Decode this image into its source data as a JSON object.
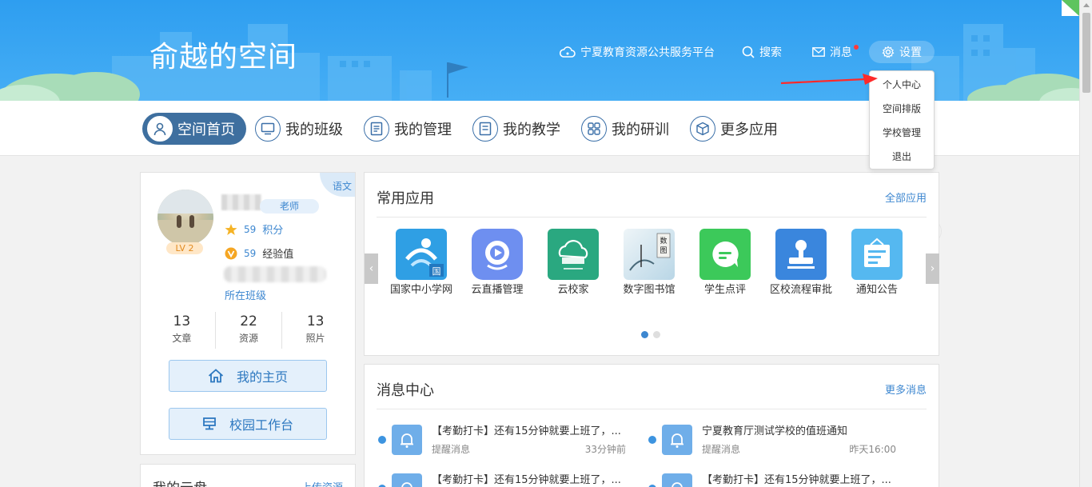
{
  "header": {
    "site_title": "俞越的空间",
    "platform_link": "宁夏教育资源公共服务平台",
    "search_label": "搜索",
    "message_label": "消息",
    "settings_label": "设置"
  },
  "settings_menu": {
    "items": [
      "个人中心",
      "空间排版",
      "学校管理",
      "退出"
    ]
  },
  "main_nav": {
    "items": [
      {
        "label": "空间首页",
        "icon": "user-icon",
        "active": true
      },
      {
        "label": "我的班级",
        "icon": "monitor-icon",
        "active": false
      },
      {
        "label": "我的管理",
        "icon": "document-icon",
        "active": false
      },
      {
        "label": "我的教学",
        "icon": "lesson-icon",
        "active": false
      },
      {
        "label": "我的研训",
        "icon": "grid-icon",
        "active": false
      },
      {
        "label": "更多应用",
        "icon": "cube-icon",
        "active": false
      }
    ]
  },
  "profile": {
    "subject_tag": "语文",
    "level": "LV 2",
    "role": "老师",
    "points_value": "59",
    "points_label": "积分",
    "exp_value": "59",
    "exp_label": "经验值",
    "class_link": "所在班级",
    "counts": [
      {
        "value": "13",
        "label": "文章"
      },
      {
        "value": "22",
        "label": "资源"
      },
      {
        "value": "13",
        "label": "照片"
      }
    ],
    "home_button": "我的主页",
    "workbench_button": "校园工作台"
  },
  "cloud_disk": {
    "title": "我的云盘",
    "upload_link": "上传资源"
  },
  "apps": {
    "title": "常用应用",
    "all_link": "全部应用",
    "items": [
      {
        "label": "国家中小学网",
        "icon": "national-school-icon",
        "color": "#2f9fe4"
      },
      {
        "label": "云直播管理",
        "icon": "live-play-icon",
        "color": "#6e8ff0"
      },
      {
        "label": "云校家",
        "icon": "cloud-school-icon",
        "color": "#2aa880"
      },
      {
        "label": "数字图书馆",
        "icon": "library-icon",
        "color": "#d8e8f0"
      },
      {
        "label": "学生点评",
        "icon": "chat-icon",
        "color": "#3cc95a"
      },
      {
        "label": "区校流程审批",
        "icon": "stamp-icon",
        "color": "#3a86dd"
      },
      {
        "label": "通知公告",
        "icon": "notice-icon",
        "color": "#55b8f0"
      }
    ],
    "page_count": 2,
    "current_page": 1
  },
  "messages": {
    "title": "消息中心",
    "more_link": "更多消息",
    "items": [
      {
        "title": "【考勤打卡】还有15分钟就要上班了，...",
        "type": "提醒消息",
        "time": "33分钟前"
      },
      {
        "title": "宁夏教育厅测试学校的值班通知",
        "type": "提醒消息",
        "time": "昨天16:00"
      },
      {
        "title": "【考勤打卡】还有15分钟就要上班了，...",
        "type": "",
        "time": ""
      },
      {
        "title": "【考勤打卡】还有15分钟就要上班了，...",
        "type": "",
        "time": ""
      }
    ]
  },
  "colors": {
    "header_blue": "#2e9ef0",
    "accent": "#3d87d0",
    "nav_active": "#3e6f9f",
    "annotation_arrow": "#ff2a2a"
  }
}
